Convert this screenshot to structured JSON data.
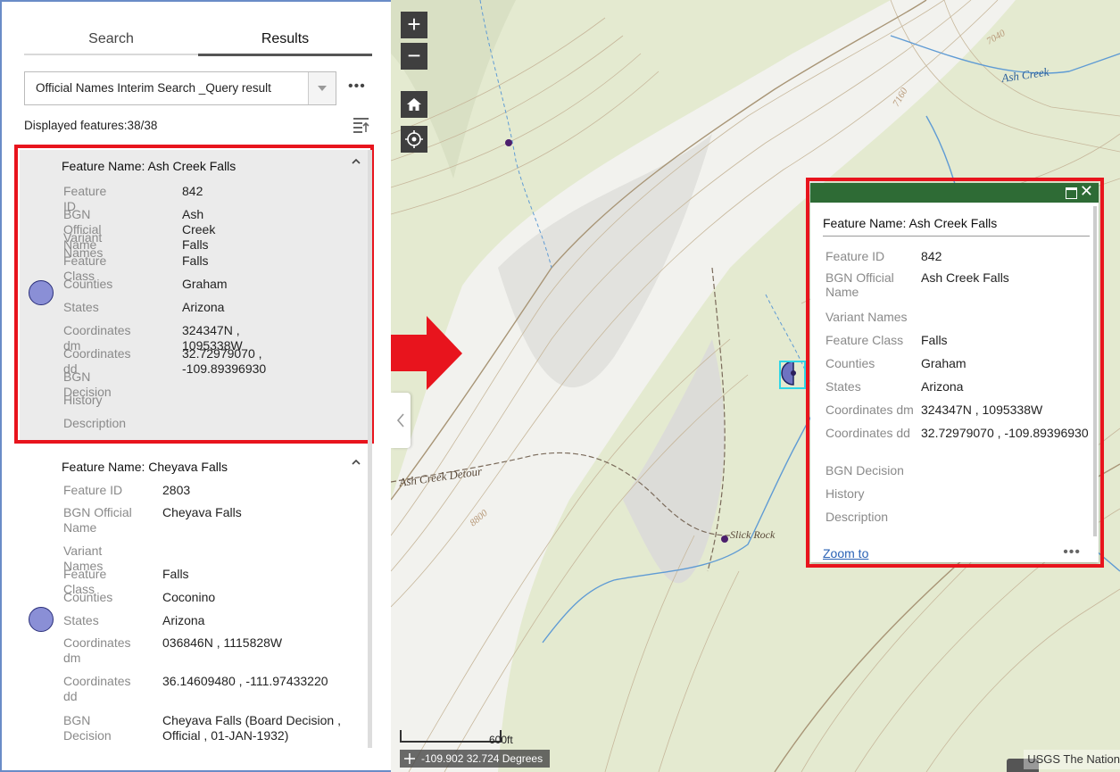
{
  "tabs": {
    "search": "Search",
    "results": "Results"
  },
  "layer_select": {
    "value": "Official Names Interim Search _Query result"
  },
  "more_label": "•••",
  "count_label": "Displayed features:38/38",
  "records": [
    {
      "title": "Feature Name: Ash Creek Falls",
      "rows": [
        {
          "k": "Feature ID",
          "v": "842"
        },
        {
          "k": "BGN Official Name",
          "v": "Ash Creek Falls"
        },
        {
          "k": "Variant Names",
          "v": ""
        },
        {
          "k": "Feature Class",
          "v": "Falls"
        },
        {
          "k": "Counties",
          "v": "Graham"
        },
        {
          "k": "States",
          "v": "Arizona"
        },
        {
          "k": "Coordinates dm",
          "v": "324347N , 1095338W"
        },
        {
          "k": "Coordinates dd",
          "v": "32.72979070 , -109.89396930"
        },
        {
          "k": "BGN Decision",
          "v": ""
        },
        {
          "k": "History",
          "v": ""
        },
        {
          "k": "Description",
          "v": ""
        }
      ]
    },
    {
      "title": "Feature Name: Cheyava Falls",
      "rows": [
        {
          "k": "Feature ID",
          "v": "2803"
        },
        {
          "k": "BGN Official Name",
          "v": "Cheyava Falls"
        },
        {
          "k": "Variant Names",
          "v": ""
        },
        {
          "k": "Feature Class",
          "v": "Falls"
        },
        {
          "k": "Counties",
          "v": "Coconino"
        },
        {
          "k": "States",
          "v": "Arizona"
        },
        {
          "k": "Coordinates dm",
          "v": "036846N , 1115828W"
        },
        {
          "k": "Coordinates dd",
          "v": "36.14609480 , -111.97433220"
        },
        {
          "k": "BGN Decision",
          "v": "Cheyava Falls (Board Decision , Official , 01-JAN-1932)"
        }
      ]
    }
  ],
  "map": {
    "zoom_in": "+",
    "zoom_out": "−",
    "labels": {
      "ash_creek": "Ash Creek",
      "detour": "Ash Creek Detour",
      "slick_rock": "Slick Rock",
      "elev_8800": "8800",
      "elev_7160": "7160",
      "elev_7040": "7040"
    },
    "scale_label": "600ft",
    "coords": "-109.902 32.724 Degrees",
    "attribution": "USGS The Nation"
  },
  "popup": {
    "title": "Feature Name: Ash Creek Falls",
    "rows": [
      {
        "k": "Feature ID",
        "v": "842"
      },
      {
        "k": "BGN Official Name",
        "v": "Ash Creek Falls"
      },
      {
        "k": "Variant Names",
        "v": ""
      },
      {
        "k": "Feature Class",
        "v": "Falls"
      },
      {
        "k": "Counties",
        "v": "Graham"
      },
      {
        "k": "States",
        "v": "Arizona"
      },
      {
        "k": "Coordinates dm",
        "v": "324347N , 1095338W"
      },
      {
        "k": "Coordinates dd",
        "v": "32.72979070 , -109.89396930"
      },
      {
        "k": "BGN Decision",
        "v": ""
      },
      {
        "k": "History",
        "v": ""
      },
      {
        "k": "Description",
        "v": ""
      }
    ],
    "zoom_to": "Zoom to",
    "more": "•••",
    "close": "✕"
  },
  "colors": {
    "highlight": "#e8141d",
    "popup_header": "#2e6b35",
    "feature_dot": "#8a8fd6",
    "arrow": "#e8141d"
  }
}
